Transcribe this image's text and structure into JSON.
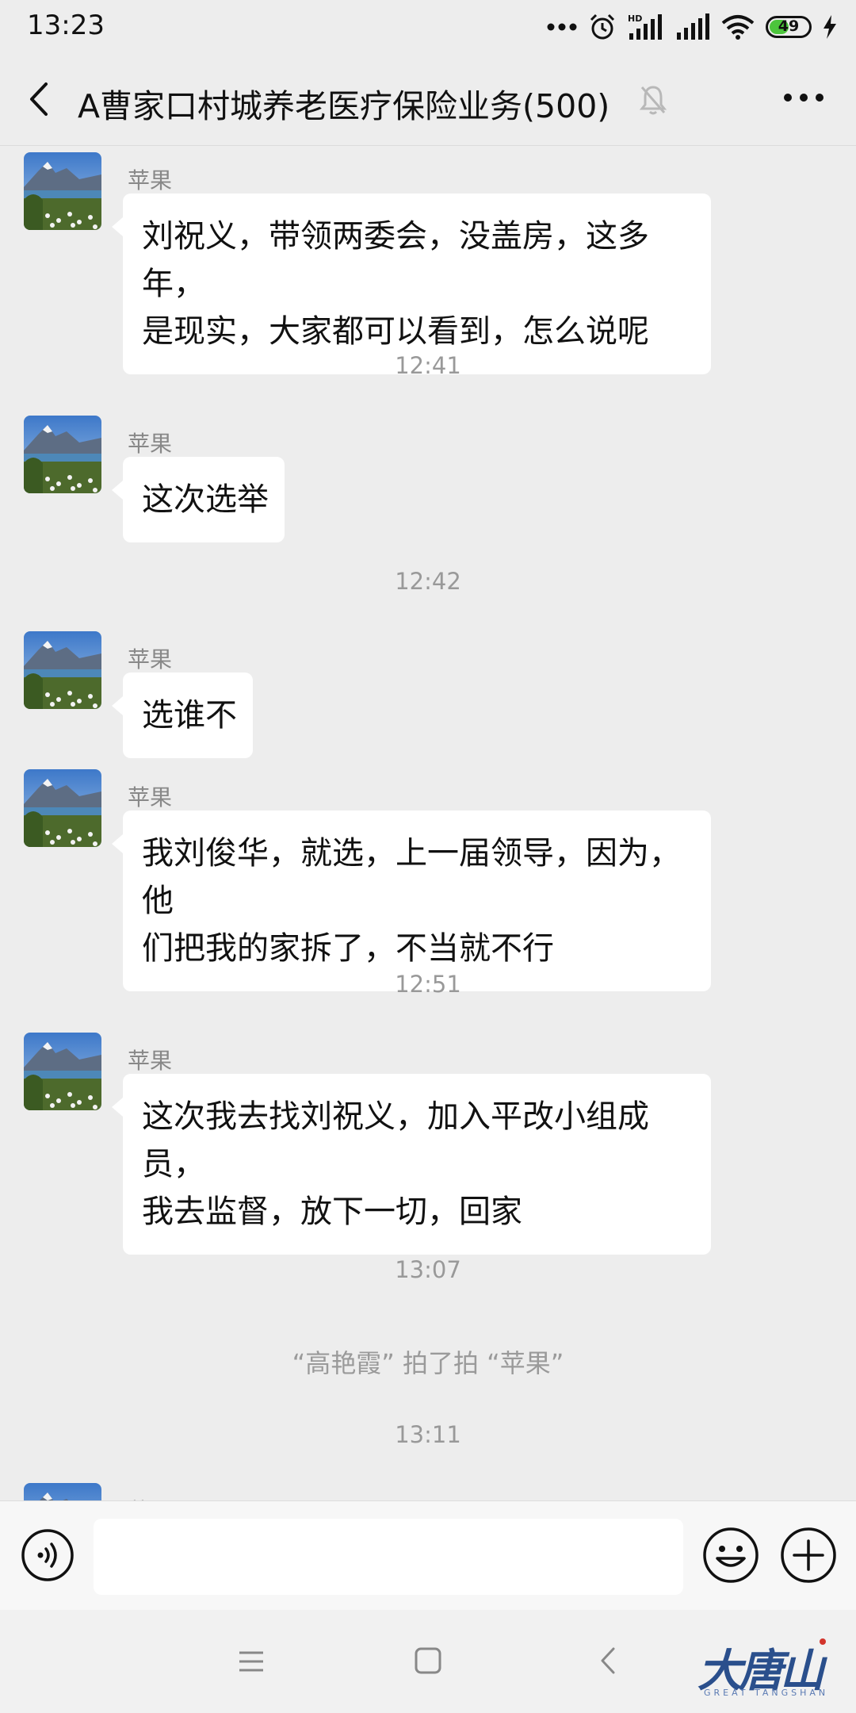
{
  "status_bar": {
    "time": "13:23",
    "battery": "49",
    "battery_level": 0.49,
    "network_label": "HD"
  },
  "header": {
    "title": "A曹家口村城养老医疗保险业务(500)"
  },
  "messages": [
    {
      "sender": "苹果",
      "text_lines": [
        "刘祝义，带领两委会，没盖房，这多年，",
        "是现实，大家都可以看到，怎么说呢"
      ]
    },
    {
      "sender": "苹果",
      "text_lines": [
        "这次选举"
      ]
    },
    {
      "sender": "苹果",
      "text_lines": [
        "选谁不"
      ]
    },
    {
      "sender": "苹果",
      "text_lines": [
        "我刘俊华，就选，上一届领导，因为，他",
        "们把我的家拆了，不当就不行"
      ]
    },
    {
      "sender": "苹果",
      "text_lines": [
        "这次我去找刘祝义，加入平改小组成员，",
        "我去监督，放下一切，回家"
      ]
    },
    {
      "sender": "苹果",
      "text_lines": []
    }
  ],
  "time_separators": [
    "12:41",
    "12:42",
    "12:51",
    "13:07",
    "13:11"
  ],
  "system_message": "“高艳霞” 拍了拍 “苹果”",
  "input": {
    "value": "",
    "placeholder": ""
  },
  "watermark": {
    "cn": "大唐山",
    "en": "GREAT TANGSHAN"
  },
  "colors": {
    "background": "#ededed",
    "bubble": "#ffffff",
    "battery": "#4cc53c",
    "watermark": "#2a4f8c"
  }
}
